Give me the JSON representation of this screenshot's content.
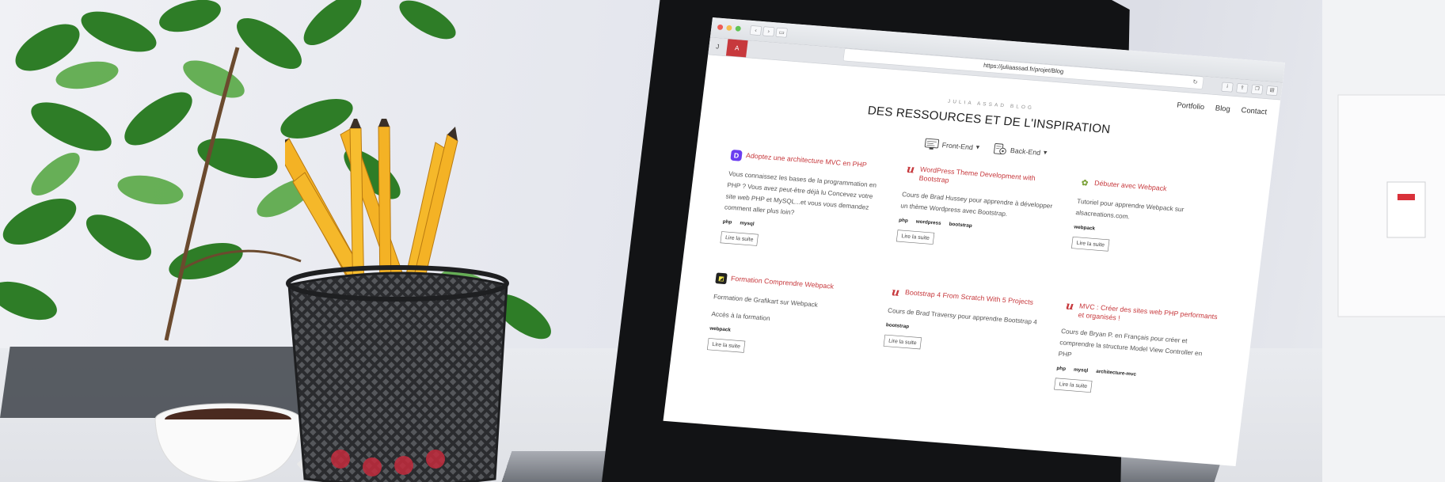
{
  "browser": {
    "url": "https://juliaassad.fr/projet/Blog",
    "tabs": [
      "J",
      "A"
    ],
    "nav_icons": [
      "back-icon",
      "forward-icon",
      "sidebar-icon"
    ],
    "toolbar_icons": [
      "info-icon",
      "share-icon",
      "tabs-icon",
      "sidebar-toggle-icon"
    ]
  },
  "site": {
    "nav": [
      "Portfolio",
      "Blog",
      "Contact"
    ],
    "brand": "JULIA ASSAD BLOG",
    "headline": "DES RESSOURCES ET DE L'INSPIRATION",
    "filters": [
      {
        "label": "Front-End",
        "icon": "front-end-icon"
      },
      {
        "label": "Back-End",
        "icon": "back-end-icon"
      }
    ]
  },
  "cards": [
    {
      "logo": "openclassrooms-icon",
      "title": "Adoptez une architecture MVC en PHP",
      "desc": [
        "Vous connaissez les bases de la programmation en PHP ? Vous avez peut-être déjà lu Concevez votre site web PHP et MySQL...et vous vous demandez comment aller plus loin?"
      ],
      "tags": [
        "php",
        "mysql"
      ],
      "button": "Lire la suite"
    },
    {
      "logo": "udemy-icon",
      "title": "WordPress Theme Development with Bootstrap",
      "desc": [
        "Cours de Brad Hussey pour apprendre à développer un thème Wordpress avec Bootstrap."
      ],
      "tags": [
        "php",
        "wordpress",
        "bootstrap"
      ],
      "button": "Lire la suite"
    },
    {
      "logo": "alsacreations-icon",
      "title": "Débuter avec Webpack",
      "desc": [
        "Tutoriel pour apprendre Webpack sur alsacreations.com."
      ],
      "tags": [
        "webpack"
      ],
      "button": "Lire la suite"
    },
    {
      "logo": "grafikart-icon",
      "title": "Formation Comprendre Webpack",
      "desc": [
        "Formation de Grafikart sur Webpack",
        "Accès à la formation"
      ],
      "tags": [
        "webpack"
      ],
      "button": "Lire la suite"
    },
    {
      "logo": "udemy-icon",
      "title": "Bootstrap 4 From Scratch With 5 Projects",
      "desc": [
        "Cours de Brad Traversy pour apprendre Bootstrap 4"
      ],
      "tags": [
        "bootstrap"
      ],
      "button": "Lire la suite"
    },
    {
      "logo": "udemy-icon",
      "title": "MVC : Créer des sites web PHP performants et organisés !",
      "desc": [
        "Cours de Bryan P. en Français pour créer et comprendre la structure Model View Controller en PHP"
      ],
      "tags": [
        "php",
        "mysql",
        "architecture-mvc"
      ],
      "button": "Lire la suite"
    }
  ],
  "colors": {
    "accent": "#c7393d",
    "text": "#555555",
    "laptop_bezel": "#121315",
    "pencil": "#f4b225",
    "background": "#e4e6ed"
  }
}
